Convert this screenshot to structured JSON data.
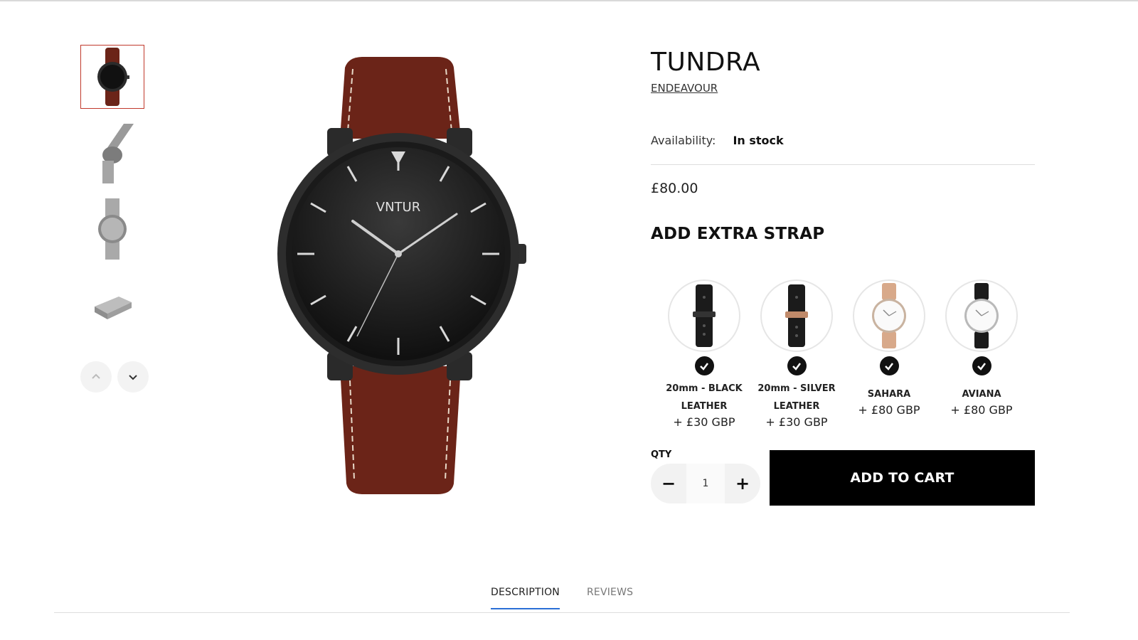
{
  "product": {
    "title": "TUNDRA",
    "collection_link": "ENDEAVOUR",
    "availability_label": "Availability:",
    "availability_value": "In stock",
    "price": "£80.00",
    "watch_brand_text": "VNTUR"
  },
  "extras": {
    "heading": "ADD EXTRA STRAP",
    "straps": [
      {
        "name_line1": "20mm - BLACK",
        "name_line2": "LEATHER",
        "price": "+ £30 GBP",
        "icon": "black-strap-icon"
      },
      {
        "name_line1": "20mm - SILVER",
        "name_line2": "LEATHER",
        "price": "+ £30 GBP",
        "icon": "black-strap-rose-buckle-icon"
      },
      {
        "name_line1": "SAHARA",
        "name_line2": "",
        "price": "+ £80 GBP",
        "icon": "tan-watch-icon"
      },
      {
        "name_line1": "AVIANA",
        "name_line2": "",
        "price": "+ £80 GBP",
        "icon": "black-watch-icon"
      }
    ]
  },
  "purchase": {
    "qty_label": "QTY",
    "qty_value": "1",
    "minus": "−",
    "plus": "+",
    "add_to_cart": "ADD TO CART"
  },
  "tabs": [
    {
      "label": "DESCRIPTION",
      "active": true
    },
    {
      "label": "REVIEWS",
      "active": false
    }
  ],
  "colors": {
    "accent_active_thumb": "#c0392b",
    "tab_underline": "#2a6fd6",
    "strap_brown": "#6b2418",
    "button_black": "#000000"
  }
}
